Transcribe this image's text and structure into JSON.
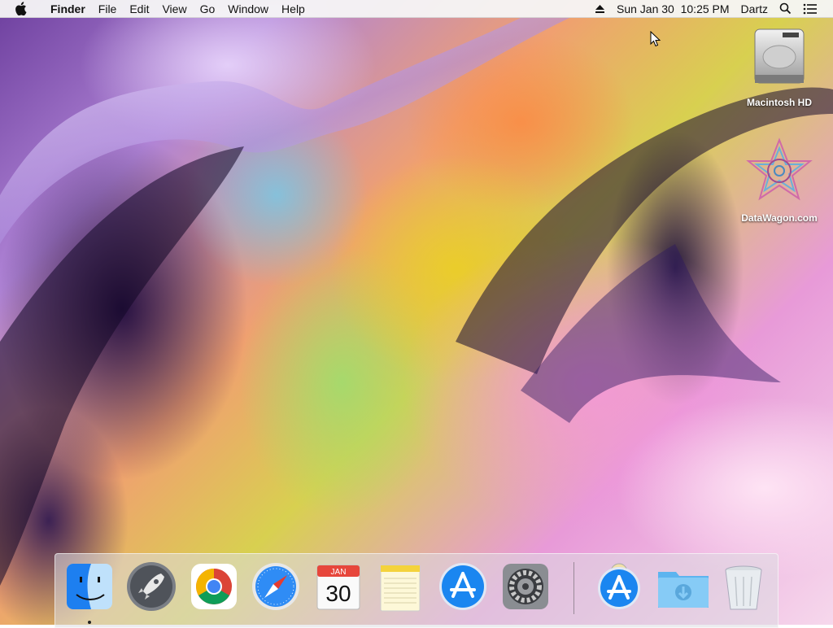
{
  "menubar": {
    "app_name": "Finder",
    "menus": [
      "File",
      "Edit",
      "View",
      "Go",
      "Window",
      "Help"
    ],
    "status": {
      "eject_icon": "eject-icon",
      "datetime": "Sun Jan 30  10:25 PM",
      "user": "Dartz",
      "spotlight_icon": "search-icon",
      "notification_icon": "list-icon"
    }
  },
  "desktop": {
    "icons": [
      {
        "label": "Macintosh HD",
        "icon": "hard-drive-icon"
      },
      {
        "label": "DataWagon.com",
        "icon": "mandala-icon"
      }
    ]
  },
  "dock": {
    "apps": [
      {
        "name": "Finder",
        "icon": "finder-icon",
        "running": true
      },
      {
        "name": "Launchpad",
        "icon": "rocket-icon"
      },
      {
        "name": "Google Chrome",
        "icon": "chrome-icon"
      },
      {
        "name": "Safari",
        "icon": "compass-icon"
      },
      {
        "name": "Calendar",
        "icon": "calendar-icon",
        "month": "JAN",
        "day": "30"
      },
      {
        "name": "Notes",
        "icon": "notes-icon"
      },
      {
        "name": "App Store",
        "icon": "app-store-icon"
      },
      {
        "name": "System Preferences",
        "icon": "gear-icon"
      },
      {
        "name": "App Store Download",
        "icon": "app-store-download-icon"
      },
      {
        "name": "Downloads",
        "icon": "downloads-folder-icon"
      },
      {
        "name": "Trash",
        "icon": "trash-icon"
      }
    ]
  },
  "colors": {
    "menubar_bg": "#f6f6f6",
    "appstore_blue": "#1a86f0",
    "folder_blue": "#6ec0f2"
  }
}
